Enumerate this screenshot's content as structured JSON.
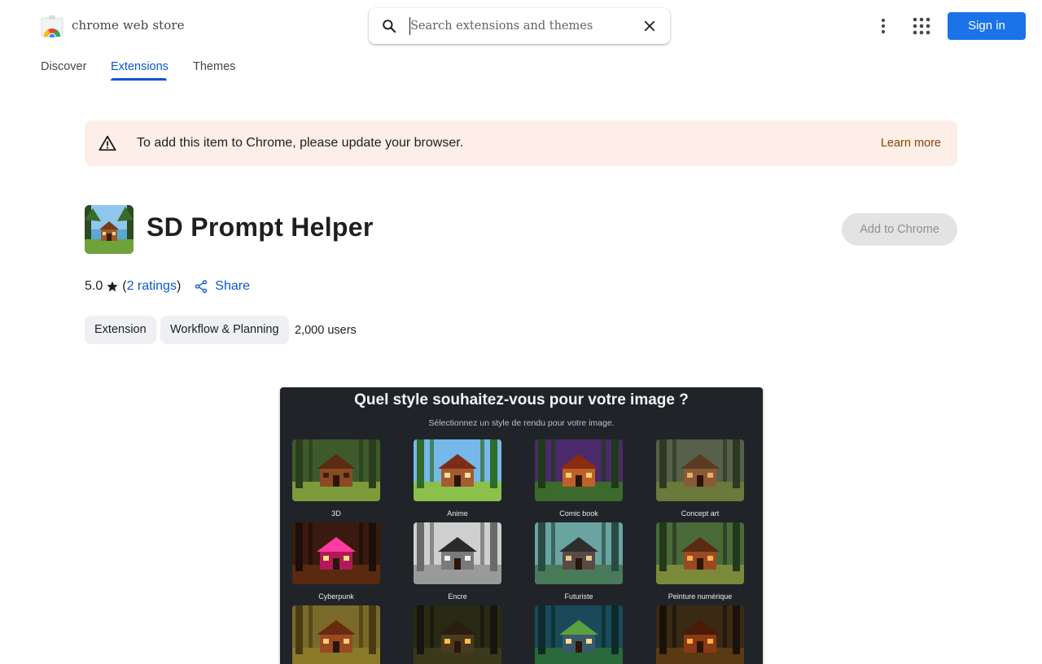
{
  "header": {
    "brand": "chrome web store",
    "search_placeholder": "Search extensions and themes",
    "sign_in_label": "Sign in"
  },
  "tabs": [
    {
      "label": "Discover",
      "active": false
    },
    {
      "label": "Extensions",
      "active": true
    },
    {
      "label": "Themes",
      "active": false
    }
  ],
  "banner": {
    "message": "To add this item to Chrome, please update your browser.",
    "learn_more": "Learn more"
  },
  "item": {
    "title": "SD Prompt Helper",
    "add_button": "Add to Chrome",
    "rating_value": "5.0",
    "ratings_link": "2 ratings",
    "share_label": "Share",
    "chips": [
      "Extension",
      "Workflow & Planning"
    ],
    "users": "2,000 users"
  },
  "screenshot": {
    "title": "Quel style souhaitez-vous pour votre image ?",
    "subtitle": "Sélectionnez un style de rendu pour votre image.",
    "styles": [
      "3D",
      "Anime",
      "Comic book",
      "Concept art",
      "Cyberpunk",
      "Encre",
      "Futuriste",
      "Peinture numérique"
    ]
  },
  "colors": {
    "accent": "#0b57d0",
    "sign_in_bg": "#1a73e8",
    "banner_bg": "#fdeee7",
    "banner_link": "#8e4300",
    "screenshot_bg": "#202428"
  },
  "icons": [
    "chrome-web-store-logo",
    "search-icon",
    "close-icon",
    "more-vert-icon",
    "apps-grid-icon",
    "warning-icon",
    "star-icon",
    "share-icon"
  ]
}
